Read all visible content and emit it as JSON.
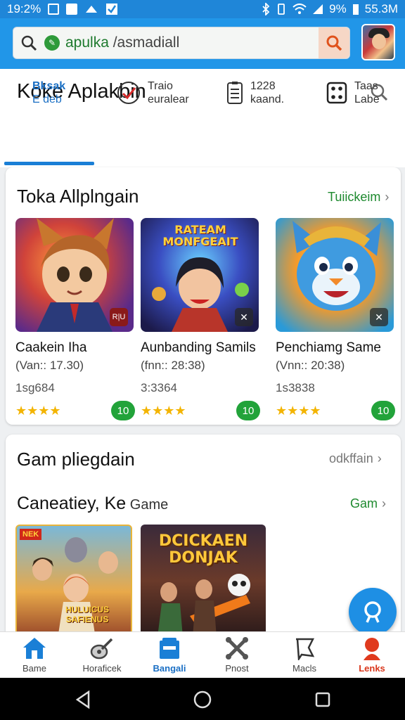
{
  "status_bar": {
    "time": "19:2%",
    "battery": "9%",
    "right_text": "55.3M"
  },
  "search": {
    "query_green": "apulka",
    "query_rest": " /asmadiall"
  },
  "header": {
    "title": "Koke Aplakbin"
  },
  "tabs": [
    {
      "line1": "Bksak",
      "line2": "E deb",
      "icon": "none"
    },
    {
      "line1": "Traio",
      "line2": "euralear",
      "icon": "check-circle-icon"
    },
    {
      "line1": "1228",
      "line2": "kaand.",
      "icon": "document-icon"
    },
    {
      "line1": "Taas",
      "line2": "Labe",
      "icon": "dice-icon"
    }
  ],
  "section1": {
    "title": "Toka Allplngain",
    "link": "Tuiickeim",
    "games": [
      {
        "name": "Caakein Iha",
        "version": "(Van:: 17.30)",
        "count": "1sg684",
        "stars": "★★★★",
        "badge": "10",
        "overlay": "R|U"
      },
      {
        "name": "Aunbanding Samils",
        "version": "(fnn:: 28:38)",
        "count": "3:3364",
        "stars": "★★★★",
        "badge": "10",
        "overlay": "✕",
        "art_title": "RATEAM MONFGEAIT"
      },
      {
        "name": "Penchiamg Same",
        "version": "(Vnn:: 20:38)",
        "count": "1s3838",
        "stars": "★★★★",
        "badge": "10",
        "overlay": "✕"
      }
    ]
  },
  "section2": {
    "title": "Gam pliegdain",
    "link": "odkffain",
    "sub_title_bold": "Caneatiey, Ke",
    "sub_title_light": "Game",
    "sub_link": "Gam",
    "thumb1_text": "HULUICUS SAFIENUS",
    "thumb1_tag": "NEK",
    "thumb2_text": "DCICKAEN DONJAK"
  },
  "bottom_nav": [
    {
      "label": "Bame",
      "icon": "home-icon"
    },
    {
      "label": "Horaficek",
      "icon": "guitar-icon"
    },
    {
      "label": "Bangali",
      "icon": "store-icon"
    },
    {
      "label": "Pnost",
      "icon": "cross-tools-icon"
    },
    {
      "label": "Macls",
      "icon": "flag-icon"
    },
    {
      "label": "Lenks",
      "icon": "person-icon"
    }
  ],
  "colors": {
    "accent": "#2196e8",
    "green": "#1e8a2f",
    "star": "#f3b400",
    "red": "#d9371c"
  }
}
